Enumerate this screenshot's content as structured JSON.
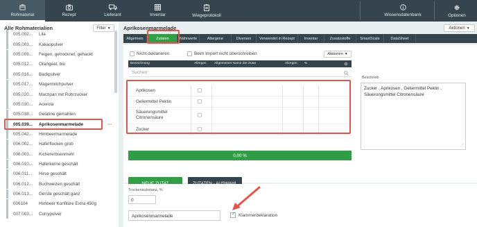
{
  "nav": {
    "items": [
      {
        "label": "Rohmaterial",
        "icon": "box-icon"
      },
      {
        "label": "Rezept",
        "icon": "camera-icon"
      },
      {
        "label": "Lieferant",
        "icon": "truck-icon"
      },
      {
        "label": "Inventar",
        "icon": "grid-icon"
      },
      {
        "label": "Wiegeprotokoll",
        "icon": "clipboard-icon"
      },
      {
        "label": "Wissensdatenbank",
        "icon": "info-icon"
      },
      {
        "label": "Optionen",
        "icon": "gear-icon"
      }
    ]
  },
  "sidebar": {
    "title": "Alle Rohmaterialien",
    "filter_label": "Filter",
    "items": [
      {
        "code": "005.002...",
        "name": "Lila"
      },
      {
        "code": "005.003...",
        "name": "Kakaopulver"
      },
      {
        "code": "005.009...",
        "name": "Feigen, getrocknet, gehackt"
      },
      {
        "code": "005.012...",
        "name": "Orangeat, bio"
      },
      {
        "code": "005.016...",
        "name": "Backpulver"
      },
      {
        "code": "005.017...",
        "name": "Magermilchpulver"
      },
      {
        "code": "005.020...",
        "name": "Marzipan mit Rohrzucker"
      },
      {
        "code": "005.030...",
        "name": "Acerola"
      },
      {
        "code": "005.038...",
        "name": "Gelatine gemahlen"
      },
      {
        "code": "005.039...",
        "name": "Aprikosenmarmelade"
      },
      {
        "code": "005.042...",
        "name": "Himbeermarmelade"
      },
      {
        "code": "006.002...",
        "name": "Haferflocken grob"
      },
      {
        "code": "006.003...",
        "name": "Kichererbsenmehl"
      },
      {
        "code": "006.010...",
        "name": "Haferkerne geschält"
      },
      {
        "code": "006.011...",
        "name": "Hirse geschält"
      },
      {
        "code": "006.012...",
        "name": "Buchweizen geschält"
      },
      {
        "code": "006.013...",
        "name": "Gerste geschält ganz"
      },
      {
        "code": "006104",
        "name": "Himbeer Konfitüre Extra 450g"
      },
      {
        "code": "007.003...",
        "name": "Currypulver"
      }
    ],
    "more_label": "···"
  },
  "main": {
    "title": "Aprikosenmarmelade",
    "aktionen": "Aktionen",
    "tabs": [
      "Allgemein",
      "Zutaten",
      "Nährwerte",
      "Allergene",
      "Diverses",
      "Verwendet in Rezept",
      "Inventar",
      "Zusatzstoffe",
      "SmartScale",
      "DataSheet"
    ],
    "nicht_deklarieren": "Nicht deklarieren",
    "import_label": "Beim Import nicht überschreiben",
    "aktionen2": "Aktionen",
    "columns": [
      "Bezeichnung",
      "Allergen",
      "Allgemeiner Name der Zutat",
      "Allergen",
      "%"
    ],
    "search_placeholder": "Suchen",
    "rows": [
      {
        "name": "Aprikosen"
      },
      {
        "name": "Geliermittel Pektin"
      },
      {
        "name": "Säuerungsmittel Citronensäure"
      },
      {
        "name": "Zucker"
      }
    ],
    "progress_label": "0,00 %",
    "progress_fraction": 1.0,
    "btn_new": "NEUE ZUTAT",
    "btn_select": "ZUTATEN - AUSWAHL",
    "beschrieb_label": "Beschrieb",
    "beschrieb_text": "Zucker , Aprikosen , Geliermittel Pektin , Säuerungsmittel Citronensäure",
    "trockensubstanz_label": "Trockensubstanz, %",
    "trockensubstanz_value": "0",
    "recipe_name": "Aprikosenmarmelade",
    "klammer_label": "Klammerdeklaration"
  },
  "colors": {
    "nav_bg": "#36454d",
    "accent_green": "#2f9e44",
    "highlight_red": "#e5544b"
  }
}
